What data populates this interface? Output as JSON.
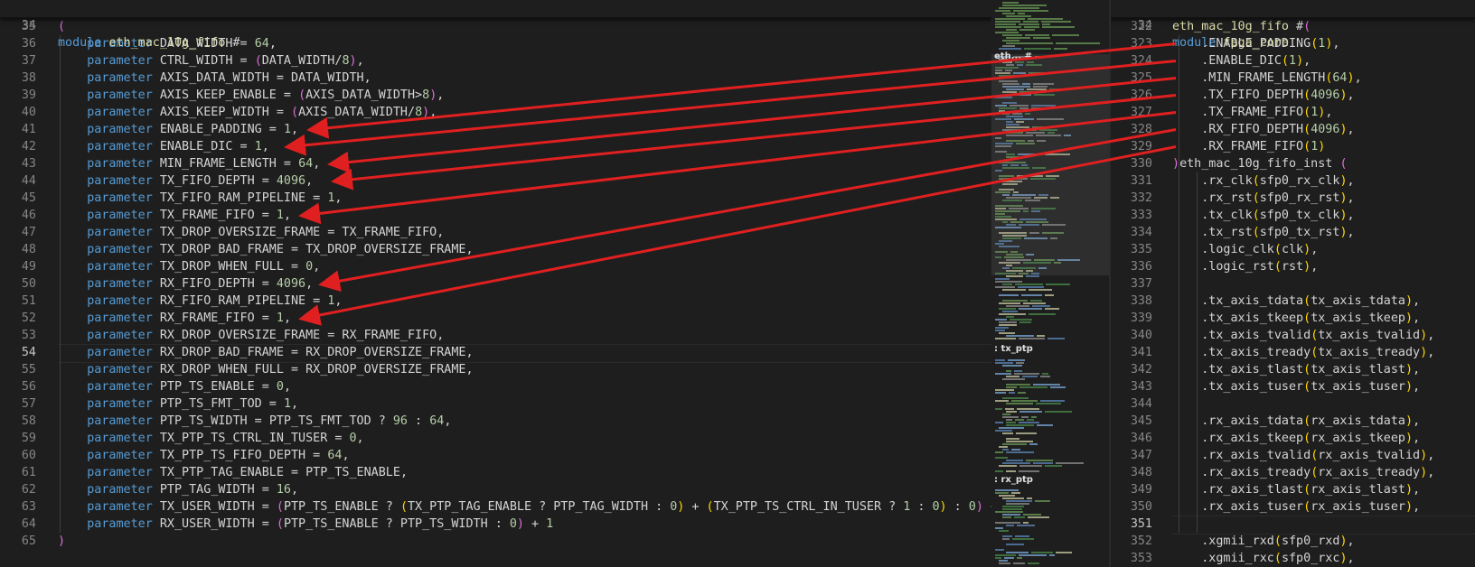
{
  "left_editor": {
    "sticky": {
      "ln": "34",
      "keyword": "module",
      "name": "eth_mac_10g_fifo",
      "rest": " #"
    },
    "active_line": "54",
    "lines": [
      {
        "ln": "34",
        "kind": "module",
        "keyword": "module",
        "name": "eth_mac_10g_fifo",
        "rest": " #"
      },
      {
        "ln": "35",
        "kind": "open",
        "text": "("
      },
      {
        "ln": "36",
        "kind": "param",
        "name": "DATA_WIDTH",
        "value": "64",
        "end": ","
      },
      {
        "ln": "37",
        "kind": "param_expr",
        "name": "CTRL_WIDTH",
        "expr": "(DATA_WIDTH/8)",
        "end": ","
      },
      {
        "ln": "38",
        "kind": "param_id",
        "name": "AXIS_DATA_WIDTH",
        "value": "DATA_WIDTH",
        "end": ","
      },
      {
        "ln": "39",
        "kind": "param_expr",
        "name": "AXIS_KEEP_ENABLE",
        "expr": "(AXIS_DATA_WIDTH>8)",
        "end": ","
      },
      {
        "ln": "40",
        "kind": "param_expr",
        "name": "AXIS_KEEP_WIDTH",
        "expr": "(AXIS_DATA_WIDTH/8)",
        "end": ","
      },
      {
        "ln": "41",
        "kind": "param",
        "name": "ENABLE_PADDING",
        "value": "1",
        "end": ","
      },
      {
        "ln": "42",
        "kind": "param",
        "name": "ENABLE_DIC",
        "value": "1",
        "end": ","
      },
      {
        "ln": "43",
        "kind": "param",
        "name": "MIN_FRAME_LENGTH",
        "value": "64",
        "end": ","
      },
      {
        "ln": "44",
        "kind": "param",
        "name": "TX_FIFO_DEPTH",
        "value": "4096",
        "end": ","
      },
      {
        "ln": "45",
        "kind": "param",
        "name": "TX_FIFO_RAM_PIPELINE",
        "value": "1",
        "end": ","
      },
      {
        "ln": "46",
        "kind": "param",
        "name": "TX_FRAME_FIFO",
        "value": "1",
        "end": ","
      },
      {
        "ln": "47",
        "kind": "param_id",
        "name": "TX_DROP_OVERSIZE_FRAME",
        "value": "TX_FRAME_FIFO",
        "end": ","
      },
      {
        "ln": "48",
        "kind": "param_id",
        "name": "TX_DROP_BAD_FRAME",
        "value": "TX_DROP_OVERSIZE_FRAME",
        "end": ","
      },
      {
        "ln": "49",
        "kind": "param",
        "name": "TX_DROP_WHEN_FULL",
        "value": "0",
        "end": ","
      },
      {
        "ln": "50",
        "kind": "param",
        "name": "RX_FIFO_DEPTH",
        "value": "4096",
        "end": ","
      },
      {
        "ln": "51",
        "kind": "param",
        "name": "RX_FIFO_RAM_PIPELINE",
        "value": "1",
        "end": ","
      },
      {
        "ln": "52",
        "kind": "param",
        "name": "RX_FRAME_FIFO",
        "value": "1",
        "end": ","
      },
      {
        "ln": "53",
        "kind": "param_id",
        "name": "RX_DROP_OVERSIZE_FRAME",
        "value": "RX_FRAME_FIFO",
        "end": ","
      },
      {
        "ln": "54",
        "kind": "param_id",
        "name": "RX_DROP_BAD_FRAME",
        "value": "RX_DROP_OVERSIZE_FRAME",
        "end": ","
      },
      {
        "ln": "55",
        "kind": "param_id",
        "name": "RX_DROP_WHEN_FULL",
        "value": "RX_DROP_OVERSIZE_FRAME",
        "end": ","
      },
      {
        "ln": "56",
        "kind": "param",
        "name": "PTP_TS_ENABLE",
        "value": "0",
        "end": ","
      },
      {
        "ln": "57",
        "kind": "param",
        "name": "PTP_TS_FMT_TOD",
        "value": "1",
        "end": ","
      },
      {
        "ln": "58",
        "kind": "param_tern",
        "name": "PTP_TS_WIDTH",
        "cond": "PTP_TS_FMT_TOD",
        "a": "96",
        "b": "64",
        "end": ","
      },
      {
        "ln": "59",
        "kind": "param",
        "name": "TX_PTP_TS_CTRL_IN_TUSER",
        "value": "0",
        "end": ","
      },
      {
        "ln": "60",
        "kind": "param",
        "name": "TX_PTP_TS_FIFO_DEPTH",
        "value": "64",
        "end": ","
      },
      {
        "ln": "61",
        "kind": "param_id",
        "name": "TX_PTP_TAG_ENABLE",
        "value": "PTP_TS_ENABLE",
        "end": ","
      },
      {
        "ln": "62",
        "kind": "param",
        "name": "PTP_TAG_WIDTH",
        "value": "16",
        "end": ","
      },
      {
        "ln": "63",
        "kind": "param_expr",
        "name": "TX_USER_WIDTH",
        "expr": "(PTP_TS_ENABLE ? (TX_PTP_TAG_ENABLE ? PTP_TAG_WIDTH : 0) + (TX_PTP_TS_CTRL_IN_TUSER ? 1 : 0) : 0) + 1",
        "end": ","
      },
      {
        "ln": "64",
        "kind": "param_expr",
        "name": "RX_USER_WIDTH",
        "expr": "(PTP_TS_ENABLE ? PTP_TS_WIDTH : 0) + 1",
        "end": ""
      },
      {
        "ln": "65",
        "kind": "open",
        "text": ")"
      }
    ]
  },
  "minimap": {
    "labels": [
      "eth... #",
      ": tx_ptp",
      ": rx_ptp"
    ]
  },
  "right_editor": {
    "sticky": {
      "ln": "34",
      "keyword": "module",
      "name": "fpga_core"
    },
    "active_line": "351",
    "lines": [
      {
        "ln": "322",
        "text": "eth_mac_10g_fifo #("
      },
      {
        "ln": "323",
        "text": "    .ENABLE_PADDING(1),"
      },
      {
        "ln": "324",
        "text": "    .ENABLE_DIC(1),"
      },
      {
        "ln": "325",
        "text": "    .MIN_FRAME_LENGTH(64),"
      },
      {
        "ln": "326",
        "text": "    .TX_FIFO_DEPTH(4096),"
      },
      {
        "ln": "327",
        "text": "    .TX_FRAME_FIFO(1),"
      },
      {
        "ln": "328",
        "text": "    .RX_FIFO_DEPTH(4096),"
      },
      {
        "ln": "329",
        "text": "    .RX_FRAME_FIFO(1)"
      },
      {
        "ln": "330",
        "text": ")eth_mac_10g_fifo_inst ("
      },
      {
        "ln": "331",
        "text": "    .rx_clk(sfp0_rx_clk),"
      },
      {
        "ln": "332",
        "text": "    .rx_rst(sfp0_rx_rst),"
      },
      {
        "ln": "333",
        "text": "    .tx_clk(sfp0_tx_clk),"
      },
      {
        "ln": "334",
        "text": "    .tx_rst(sfp0_tx_rst),"
      },
      {
        "ln": "335",
        "text": "    .logic_clk(clk),"
      },
      {
        "ln": "336",
        "text": "    .logic_rst(rst),"
      },
      {
        "ln": "337",
        "text": ""
      },
      {
        "ln": "338",
        "text": "    .tx_axis_tdata(tx_axis_tdata),"
      },
      {
        "ln": "339",
        "text": "    .tx_axis_tkeep(tx_axis_tkeep),"
      },
      {
        "ln": "340",
        "text": "    .tx_axis_tvalid(tx_axis_tvalid),"
      },
      {
        "ln": "341",
        "text": "    .tx_axis_tready(tx_axis_tready),"
      },
      {
        "ln": "342",
        "text": "    .tx_axis_tlast(tx_axis_tlast),"
      },
      {
        "ln": "343",
        "text": "    .tx_axis_tuser(tx_axis_tuser),"
      },
      {
        "ln": "344",
        "text": ""
      },
      {
        "ln": "345",
        "text": "    .rx_axis_tdata(rx_axis_tdata),"
      },
      {
        "ln": "346",
        "text": "    .rx_axis_tkeep(rx_axis_tkeep),"
      },
      {
        "ln": "347",
        "text": "    .rx_axis_tvalid(rx_axis_tvalid),"
      },
      {
        "ln": "348",
        "text": "    .rx_axis_tready(rx_axis_tready),"
      },
      {
        "ln": "349",
        "text": "    .rx_axis_tlast(rx_axis_tlast),"
      },
      {
        "ln": "350",
        "text": "    .rx_axis_tuser(rx_axis_tuser),"
      },
      {
        "ln": "351",
        "text": ""
      },
      {
        "ln": "352",
        "text": "    .xgmii_rxd(sfp0_rxd),"
      },
      {
        "ln": "353",
        "text": "    .xgmii_rxc(sfp0_rxc),"
      }
    ]
  },
  "annotations": {
    "arrow_color": "#e02020",
    "links": [
      {
        "from": "323",
        "to": "41"
      },
      {
        "from": "324",
        "to": "42"
      },
      {
        "from": "325",
        "to": "43"
      },
      {
        "from": "326",
        "to": "44"
      },
      {
        "from": "327",
        "to": "46"
      },
      {
        "from": "328",
        "to": "50"
      },
      {
        "from": "329",
        "to": "52"
      }
    ]
  },
  "colors": {
    "background": "#1e1e1e",
    "keyword": "#569cd6",
    "module_name": "#dcdcaa",
    "number": "#b5cea8",
    "identifier": "#d4d4d4",
    "bracket_1": "#da70d6",
    "bracket_2": "#ffd700",
    "bracket_3": "#179fff"
  }
}
